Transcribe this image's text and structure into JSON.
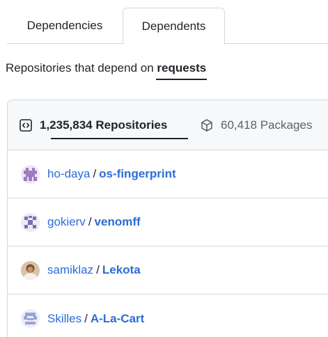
{
  "tabs": {
    "dependencies": "Dependencies",
    "dependents": "Dependents"
  },
  "intro": {
    "prefix": "Repositories that depend on ",
    "package": "requests"
  },
  "header": {
    "repositories_label": "1,235,834 Repositories",
    "packages_label": "60,418 Packages"
  },
  "rows": [
    {
      "owner": "ho-daya",
      "separator": "/",
      "repo": "os-fingerprint"
    },
    {
      "owner": "gokierv",
      "separator": "/",
      "repo": "venomff"
    },
    {
      "owner": "samiklaz",
      "separator": "/",
      "repo": "Lekota"
    },
    {
      "owner": "Skilles",
      "separator": "/",
      "repo": "A-La-Cart"
    }
  ],
  "colors": {
    "link": "#2b6cd8",
    "border": "#d0d7de",
    "header_bg": "#f6f8fa",
    "muted": "#59636e",
    "text": "#1f2328"
  },
  "icons": {
    "repositories": "code-square-icon",
    "packages": "package-box-icon"
  }
}
